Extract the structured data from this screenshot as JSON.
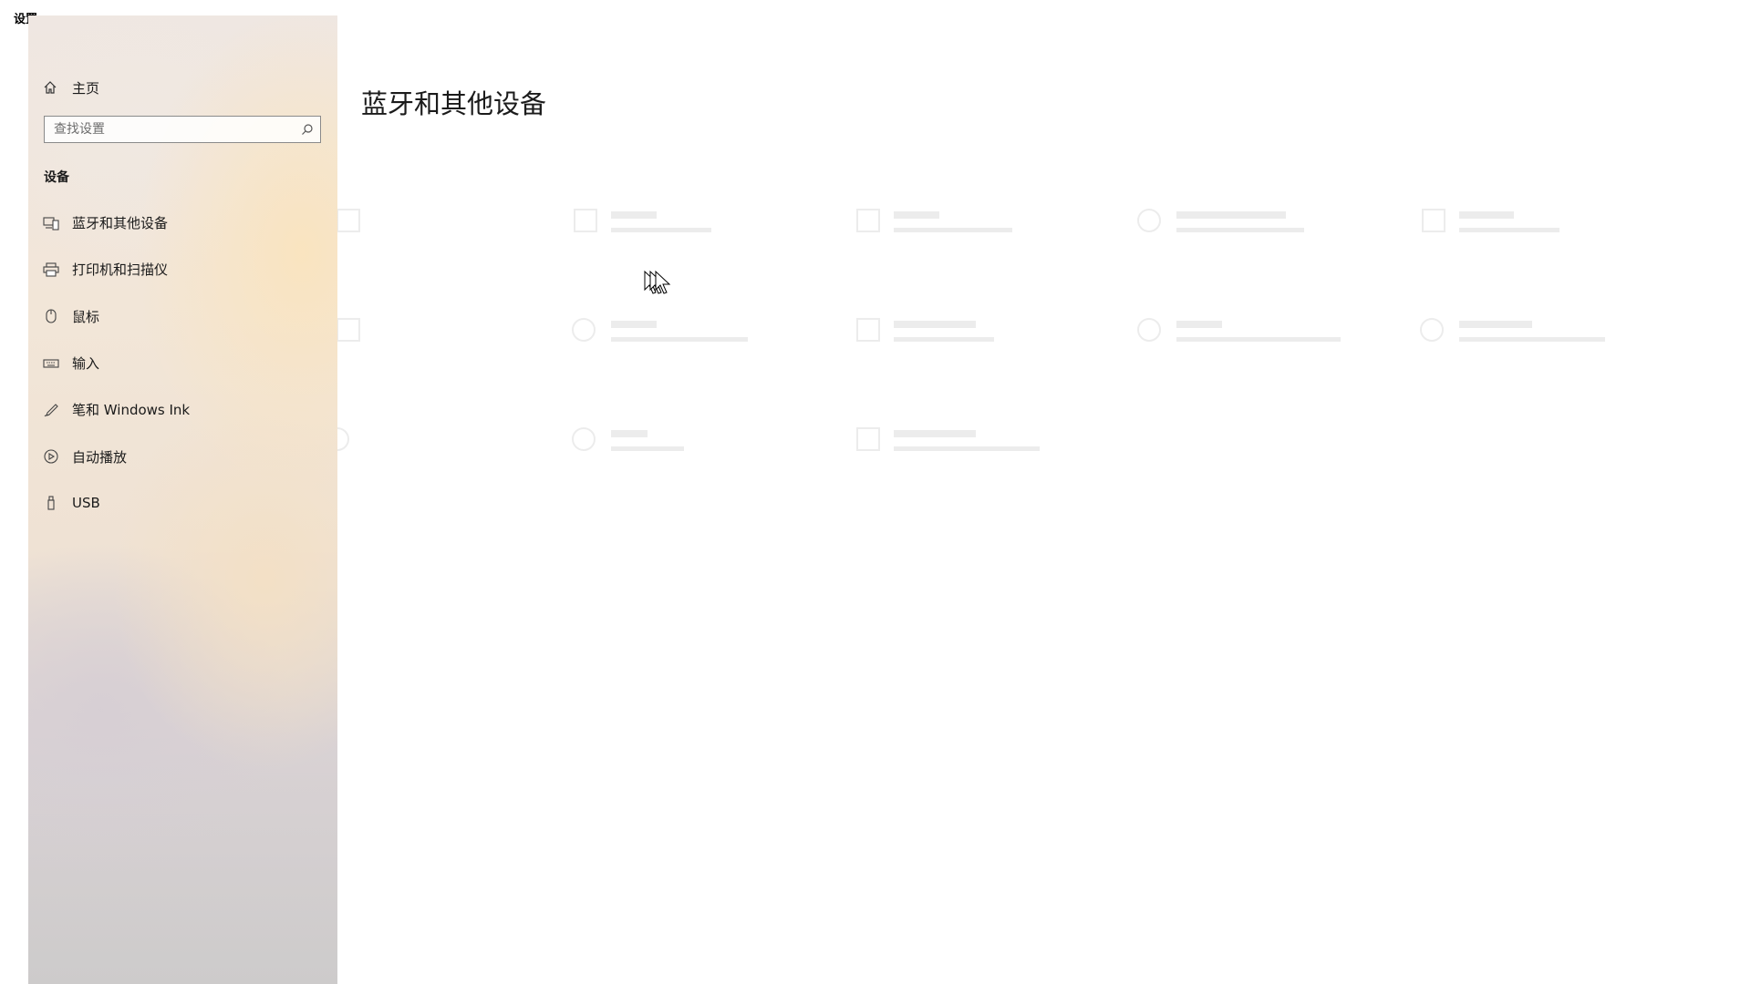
{
  "window": {
    "title": "设置"
  },
  "sidebar": {
    "home_label": "主页",
    "search_placeholder": "查找设置",
    "section_title": "设备",
    "items": [
      {
        "label": "蓝牙和其他设备",
        "icon": "bluetooth-devices-icon"
      },
      {
        "label": "打印机和扫描仪",
        "icon": "printer-icon"
      },
      {
        "label": "鼠标",
        "icon": "mouse-icon"
      },
      {
        "label": "输入",
        "icon": "keyboard-icon"
      },
      {
        "label": "笔和 Windows Ink",
        "icon": "pen-icon"
      },
      {
        "label": "自动播放",
        "icon": "autoplay-icon"
      },
      {
        "label": "USB",
        "icon": "usb-icon"
      }
    ]
  },
  "main": {
    "title": "蓝牙和其他设备"
  }
}
